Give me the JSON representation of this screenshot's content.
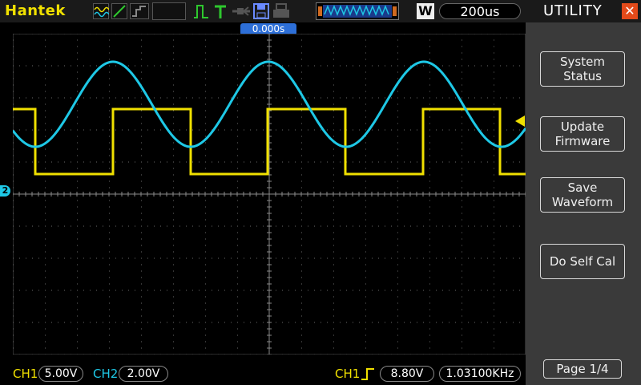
{
  "topbar": {
    "brand": "Hantek",
    "timebase": "200us",
    "window_mode": "W"
  },
  "trigger_position": "0.000s",
  "ch2_marker": "2",
  "bottombar": {
    "ch1_label": "CH1",
    "ch1_scale": "5.00V",
    "ch2_label": "CH2",
    "ch2_scale": "2.00V",
    "trig_source": "CH1",
    "trig_level": "8.80V",
    "frequency": "1.03100KHz"
  },
  "panel": {
    "title": "UTILITY",
    "buttons": [
      {
        "line1": "System",
        "line2": "Status"
      },
      {
        "line1": "Update",
        "line2": "Firmware"
      },
      {
        "line1": "Save",
        "line2": "Waveform"
      },
      {
        "line1": "Do Self Cal",
        "line2": ""
      }
    ],
    "page": "Page 1/4"
  },
  "colors": {
    "ch1": "#f0e000",
    "ch2": "#1ec8e6",
    "panel_bg": "#3a3a3a",
    "close": "#e34a1a",
    "trigger_marker": "#2d6fd8"
  },
  "icons": [
    "acquire-mode-icon",
    "rising-edge-icon",
    "stop-icon",
    "trigger-icon",
    "t-icon",
    "probe-icon",
    "save-icon",
    "print-icon",
    "waveform-memory-icon"
  ]
}
